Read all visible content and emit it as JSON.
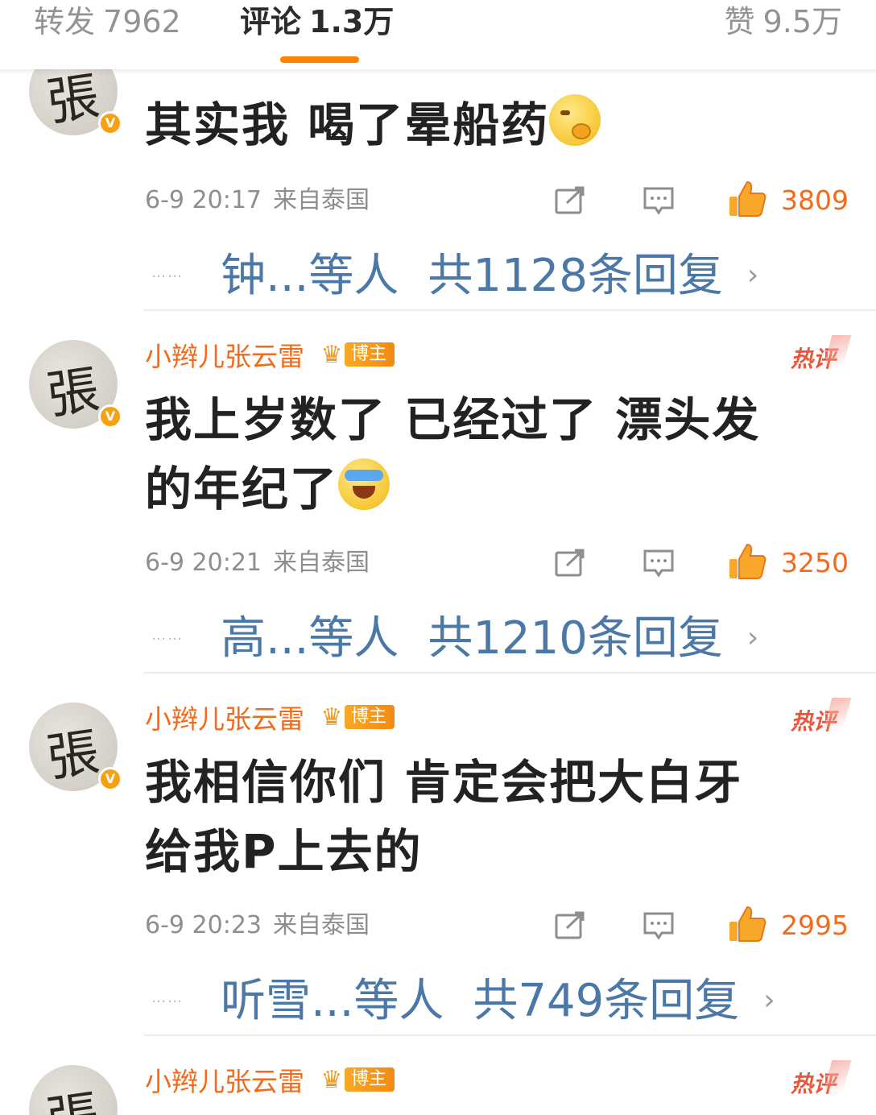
{
  "tabs": {
    "repost": {
      "label": "转发",
      "count": "7962"
    },
    "comments": {
      "label": "评论",
      "count": "1.3万"
    },
    "likes": {
      "label": "赞",
      "count": "9.5万"
    }
  },
  "comments": [
    {
      "username": "",
      "badge": "",
      "hot_label": "",
      "text": "其实我 喝了晕船药",
      "emoji": "yawn-emoji",
      "time": "6-9 20:17",
      "location": "来自泰国",
      "likes": "3809",
      "reply_names": "钟...等人",
      "reply_total": "共1128条回复"
    },
    {
      "username": "小辫儿张云雷",
      "badge": "博主",
      "hot_label": "热评",
      "text_line1": "我上岁数了 已经过了 漂头发",
      "text_line2": "的年纪了",
      "emoji": "laugh-cry-emoji",
      "time": "6-9 20:21",
      "location": "来自泰国",
      "likes": "3250",
      "reply_names": "高...等人",
      "reply_total": "共1210条回复"
    },
    {
      "username": "小辫儿张云雷",
      "badge": "博主",
      "hot_label": "热评",
      "text_line1": "我相信你们 肯定会把大白牙",
      "text_line2": "给我P上去的",
      "time": "6-9 20:23",
      "location": "来自泰国",
      "likes": "2995",
      "reply_names": "听雪...等人",
      "reply_total": "共749条回复"
    },
    {
      "username": "小辫儿张云雷",
      "badge": "博主",
      "hot_label": "热评"
    }
  ],
  "icons": {
    "avatar_glyph": "張",
    "verified_mark": "V",
    "chevron": "›",
    "dots": "……"
  },
  "colors": {
    "accent_orange": "#ff8200",
    "username": "#f26a1b",
    "reply_link": "#4c78a8",
    "hot_red": "#e8563c"
  }
}
